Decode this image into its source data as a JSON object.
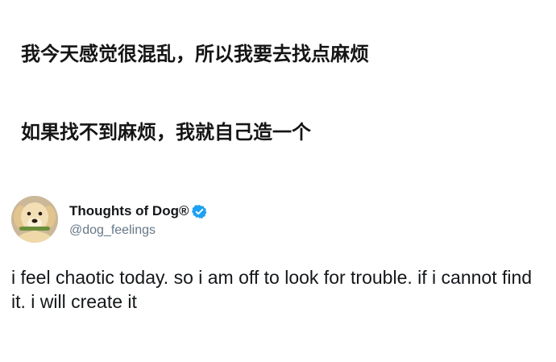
{
  "caption": {
    "line1": "我今天感觉很混乱，所以我要去找点麻烦",
    "line2": "如果找不到麻烦，我就自己造一个"
  },
  "tweet": {
    "display_name": "Thoughts of Dog®",
    "handle": "@dog_feelings",
    "verified_icon": "verified-badge-icon",
    "avatar_icon": "dog-avatar",
    "text": "i feel chaotic today. so i am off to look for trouble. if i cannot find it. i will create it",
    "verified_color": "#1da1f2"
  }
}
